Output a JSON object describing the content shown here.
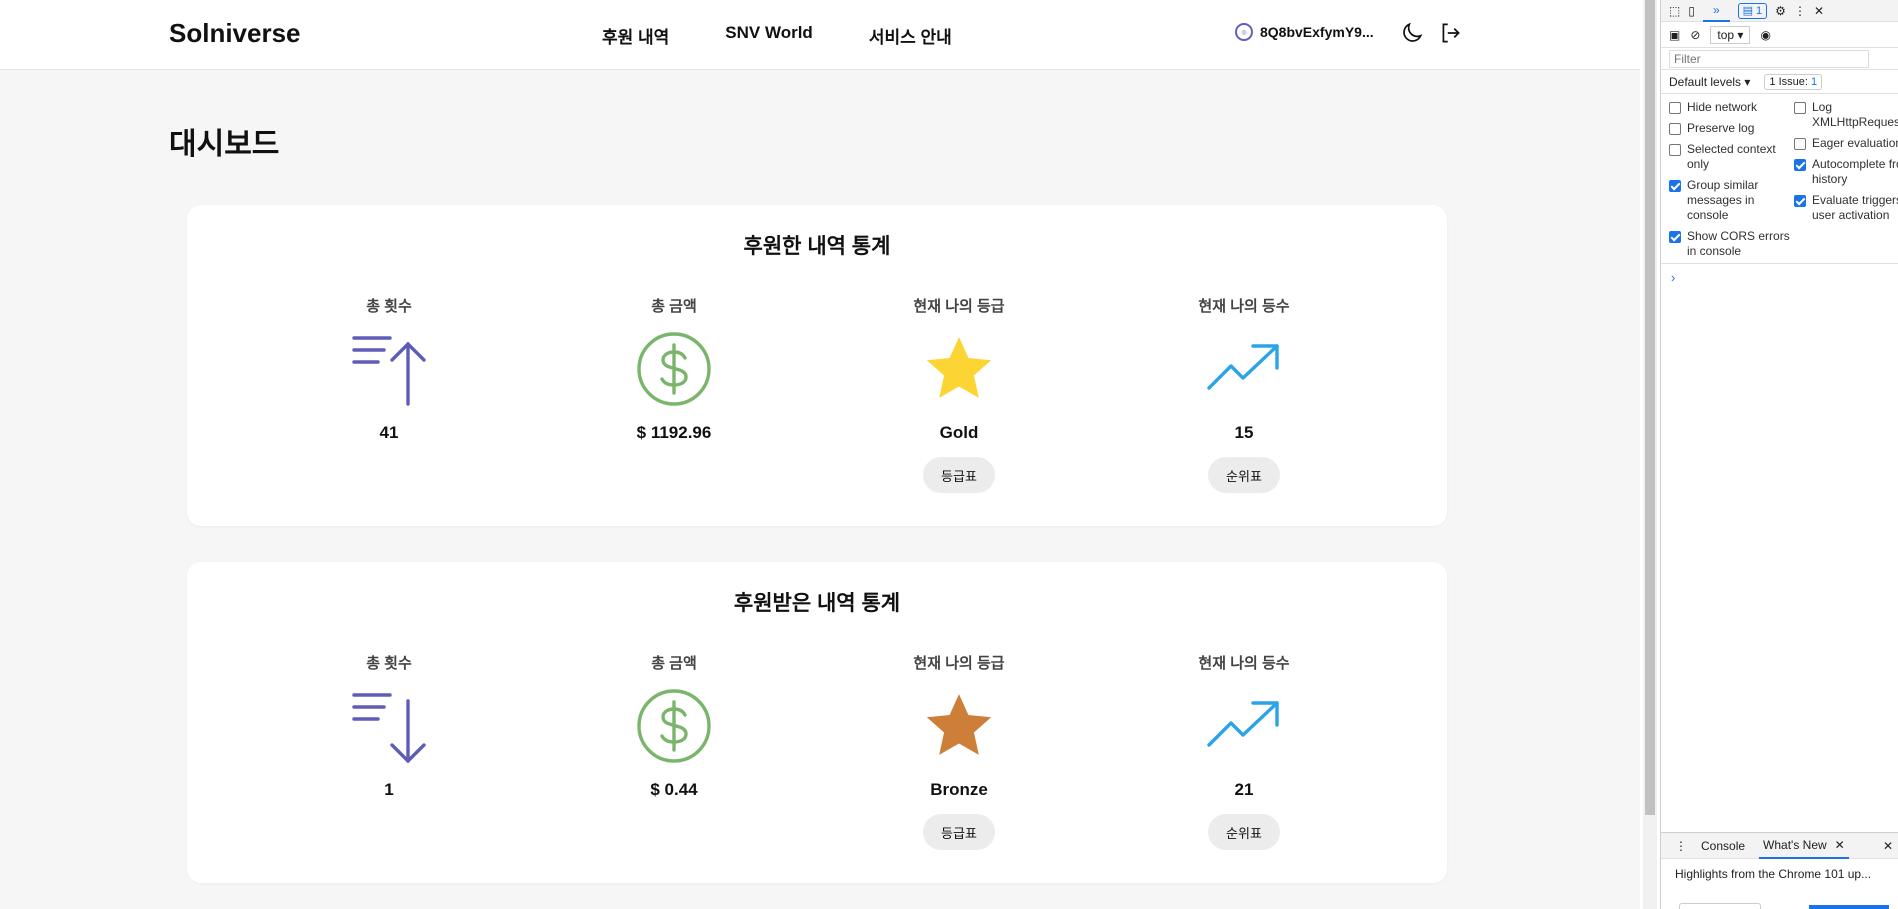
{
  "nav": {
    "brand": "Solniverse",
    "links": [
      "후원 내역",
      "SNV World",
      "서비스 안내"
    ],
    "wallet": "8Q8bvExfymY9..."
  },
  "page_title": "대시보드",
  "donated": {
    "title": "후원한 내역 통계",
    "stats": [
      {
        "label": "총 횟수",
        "value": "41",
        "icon": "sort-ascending-icon"
      },
      {
        "label": "총 금액",
        "value": "$ 1192.96",
        "icon": "dollar-circle-icon"
      },
      {
        "label": "현재 나의 등급",
        "value": "Gold",
        "icon": "star-icon",
        "button": "등급표",
        "color": "#fcd535"
      },
      {
        "label": "현재 나의 등수",
        "value": "15",
        "icon": "trending-up-icon",
        "button": "순위표"
      }
    ]
  },
  "received": {
    "title": "후원받은 내역 통계",
    "stats": [
      {
        "label": "총 횟수",
        "value": "1",
        "icon": "sort-descending-icon"
      },
      {
        "label": "총 금액",
        "value": "$ 0.44",
        "icon": "dollar-circle-icon"
      },
      {
        "label": "현재 나의 등급",
        "value": "Bronze",
        "icon": "star-icon",
        "button": "등급표",
        "color": "#cd7f3a"
      },
      {
        "label": "현재 나의 등수",
        "value": "21",
        "icon": "trending-up-icon",
        "button": "순위표"
      }
    ]
  },
  "colors": {
    "purple": "#5f5cb8",
    "green": "#7ab56b",
    "blue": "#2aa3e8",
    "gold": "#fcd535",
    "bronze": "#cd7f3a"
  },
  "devtools": {
    "issue_count": "1",
    "context": "top",
    "filter_placeholder": "Filter",
    "levels": "Default levels",
    "issues_label": "1 Issue:",
    "issues_count": "1",
    "settings_left": [
      {
        "label": "Hide network",
        "checked": false
      },
      {
        "label": "Preserve log",
        "checked": false
      },
      {
        "label": "Selected context only",
        "checked": false
      },
      {
        "label": "Group similar messages in console",
        "checked": true
      },
      {
        "label": "Show CORS errors in console",
        "checked": true
      }
    ],
    "settings_right": [
      {
        "label": "Log XMLHttpRequests",
        "checked": false
      },
      {
        "label": "Eager evaluation",
        "checked": false
      },
      {
        "label": "Autocomplete from history",
        "checked": true
      },
      {
        "label": "Evaluate triggers user activation",
        "checked": true
      }
    ],
    "drawer_tabs": [
      "Console",
      "What's New"
    ],
    "highlight": "Highlights from the Chrome 101 up..."
  }
}
